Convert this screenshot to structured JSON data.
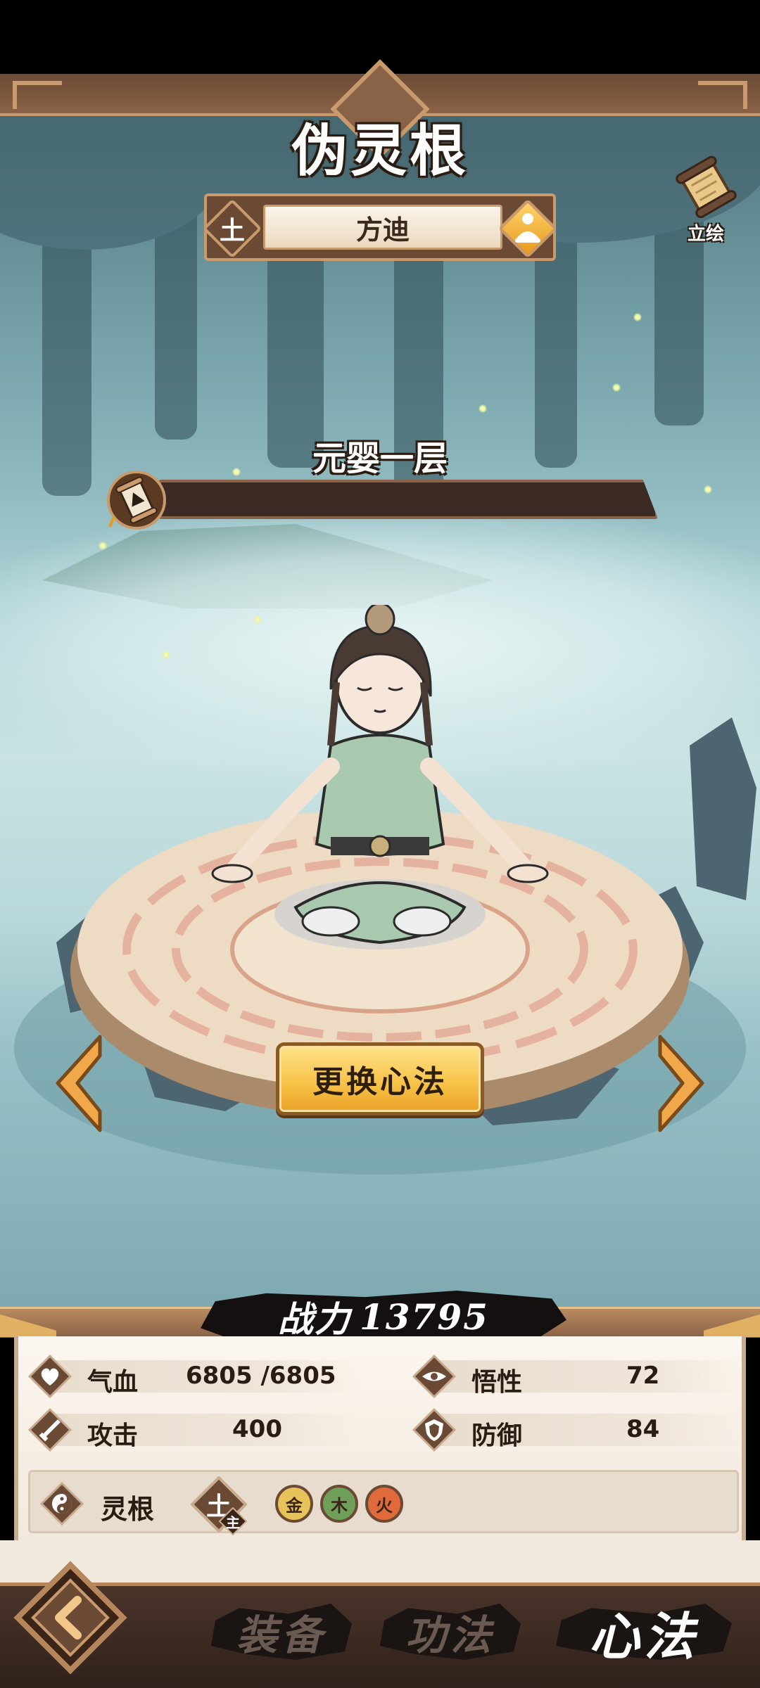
{
  "header": {
    "title": "伪灵根",
    "character_name": "方迪",
    "element": "土",
    "portrait_label": "立绘"
  },
  "cultivation": {
    "realm": "元婴一层",
    "progress": 0.0
  },
  "actions": {
    "change_method_label": "更换心法"
  },
  "combat": {
    "power_label": "战力",
    "power_value": "13795"
  },
  "stats": {
    "hp": {
      "label": "气血",
      "value": "6805 /6805"
    },
    "comprehension": {
      "label": "悟性",
      "value": "72"
    },
    "attack": {
      "label": "攻击",
      "value": "400"
    },
    "defense": {
      "label": "防御",
      "value": "84"
    }
  },
  "spirit_root": {
    "label": "灵根",
    "main": "土",
    "main_tag": "主",
    "secondary": [
      {
        "char": "金",
        "color": "#e7c35a"
      },
      {
        "char": "木",
        "color": "#6fa05a"
      },
      {
        "char": "火",
        "color": "#e06a3a"
      }
    ]
  },
  "tabs": [
    {
      "label": "装备",
      "active": false
    },
    {
      "label": "功法",
      "active": false
    },
    {
      "label": "心法",
      "active": true
    }
  ],
  "colors": {
    "frame_brown": "#6b4a35",
    "frame_gold": "#c89a6c",
    "button_gold": "#f7c145",
    "arrow_orange": "#f0a84a"
  }
}
